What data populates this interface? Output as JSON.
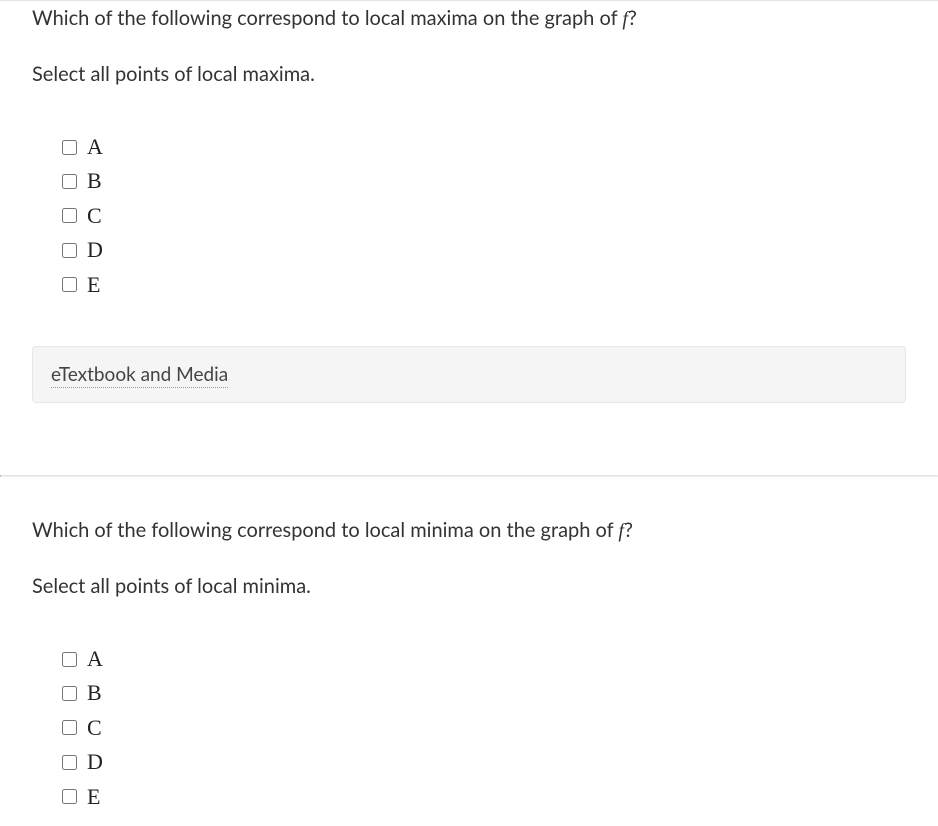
{
  "q1": {
    "prompt_pre": "Which of the following correspond to local maxima on the graph of ",
    "prompt_var": "f",
    "prompt_post": "?",
    "instruction": "Select all points of local maxima.",
    "options": [
      {
        "label": "A"
      },
      {
        "label": "B"
      },
      {
        "label": "C"
      },
      {
        "label": "D"
      },
      {
        "label": "E"
      }
    ]
  },
  "etextbook_label": "eTextbook and Media",
  "q2": {
    "prompt_pre": "Which of the following correspond to local minima on the graph of ",
    "prompt_var": "f",
    "prompt_post": "?",
    "instruction": "Select all points of local minima.",
    "options": [
      {
        "label": "A"
      },
      {
        "label": "B"
      },
      {
        "label": "C"
      },
      {
        "label": "D"
      },
      {
        "label": "E"
      }
    ]
  }
}
